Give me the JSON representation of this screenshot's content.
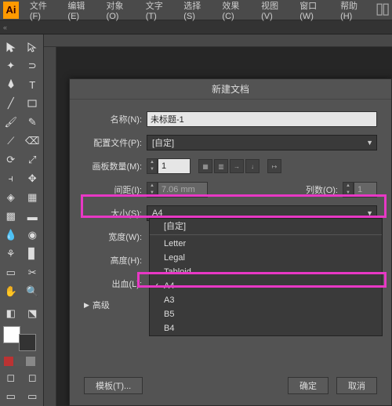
{
  "app": {
    "logo": "Ai"
  },
  "menu": {
    "file": "文件(F)",
    "edit": "编辑(E)",
    "object": "对象(O)",
    "text": "文字(T)",
    "select": "选择(S)",
    "effect": "效果(C)",
    "view": "视图(V)",
    "window": "窗口(W)",
    "help": "帮助(H)"
  },
  "dialog": {
    "title": "新建文档",
    "name_label": "名称(N):",
    "name_value": "未标题-1",
    "profile_label": "配置文件(P):",
    "profile_value": "[自定]",
    "artboards_label": "画板数量(M):",
    "artboards_value": "1",
    "spacing_label": "间距(I):",
    "spacing_value": "7.06 mm",
    "columns_label": "列数(O):",
    "columns_value": "1",
    "size_label": "大小(S):",
    "size_value": "A4",
    "width_label": "宽度(W):",
    "height_label": "高度(H):",
    "bleed_label": "出血(L):",
    "advanced_label": "高级",
    "templates_btn": "模板(T)...",
    "ok_btn": "确定",
    "cancel_btn": "取消"
  },
  "size_options": {
    "custom": "[自定]",
    "letter": "Letter",
    "legal": "Legal",
    "tabloid": "Tabloid",
    "a4": "A4",
    "a3": "A3",
    "b5": "B5",
    "b4": "B4"
  }
}
